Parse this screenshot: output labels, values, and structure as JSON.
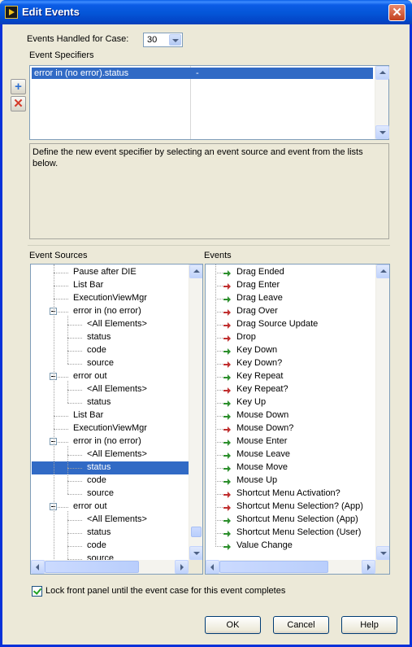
{
  "window": {
    "title": "Edit Events"
  },
  "events_handled": {
    "label": "Events Handled for Case:",
    "value": "30"
  },
  "event_specifiers": {
    "label": "Event Specifiers",
    "rows": [
      {
        "source": "error in (no error).status",
        "event": "-"
      }
    ]
  },
  "description": "Define the new event specifier by selecting an event source and event from the lists below.",
  "event_sources": {
    "label": "Event Sources",
    "items": [
      {
        "text": "Pause after DIE"
      },
      {
        "text": "List Bar"
      },
      {
        "text": "ExecutionViewMgr"
      },
      {
        "text": "error in (no error)"
      },
      {
        "text": "<All Elements>"
      },
      {
        "text": "status"
      },
      {
        "text": "code"
      },
      {
        "text": "source"
      },
      {
        "text": "error out"
      },
      {
        "text": "<All Elements>"
      },
      {
        "text": "status"
      },
      {
        "text": "List Bar"
      },
      {
        "text": "ExecutionViewMgr"
      },
      {
        "text": "error in (no error)"
      },
      {
        "text": "<All Elements>"
      },
      {
        "text": "status"
      },
      {
        "text": "code"
      },
      {
        "text": "source"
      },
      {
        "text": "error out"
      },
      {
        "text": "<All Elements>"
      },
      {
        "text": "status"
      },
      {
        "text": "code"
      },
      {
        "text": "source"
      }
    ]
  },
  "events": {
    "label": "Events",
    "items": [
      {
        "text": "Drag Ended",
        "kind": "notify"
      },
      {
        "text": "Drag Enter",
        "kind": "filter"
      },
      {
        "text": "Drag Leave",
        "kind": "notify"
      },
      {
        "text": "Drag Over",
        "kind": "filter"
      },
      {
        "text": "Drag Source Update",
        "kind": "filter"
      },
      {
        "text": "Drop",
        "kind": "filter"
      },
      {
        "text": "Key Down",
        "kind": "notify"
      },
      {
        "text": "Key Down?",
        "kind": "filter"
      },
      {
        "text": "Key Repeat",
        "kind": "notify"
      },
      {
        "text": "Key Repeat?",
        "kind": "filter"
      },
      {
        "text": "Key Up",
        "kind": "notify"
      },
      {
        "text": "Mouse Down",
        "kind": "notify"
      },
      {
        "text": "Mouse Down?",
        "kind": "filter"
      },
      {
        "text": "Mouse Enter",
        "kind": "notify"
      },
      {
        "text": "Mouse Leave",
        "kind": "notify"
      },
      {
        "text": "Mouse Move",
        "kind": "notify"
      },
      {
        "text": "Mouse Up",
        "kind": "notify"
      },
      {
        "text": "Shortcut Menu Activation?",
        "kind": "filter"
      },
      {
        "text": "Shortcut Menu Selection? (App)",
        "kind": "filter"
      },
      {
        "text": "Shortcut Menu Selection (App)",
        "kind": "notify"
      },
      {
        "text": "Shortcut Menu Selection (User)",
        "kind": "notify"
      },
      {
        "text": "Value Change",
        "kind": "notify"
      }
    ]
  },
  "lock_panel": {
    "label": "Lock front panel until the event case for this event completes",
    "checked": true
  },
  "buttons": {
    "ok": "OK",
    "cancel": "Cancel",
    "help": "Help"
  },
  "colors": {
    "selection": "#316ac5",
    "notify_arrow": "#2d8f2d",
    "filter_arrow": "#c03030",
    "title_bar": "#0455d7"
  }
}
